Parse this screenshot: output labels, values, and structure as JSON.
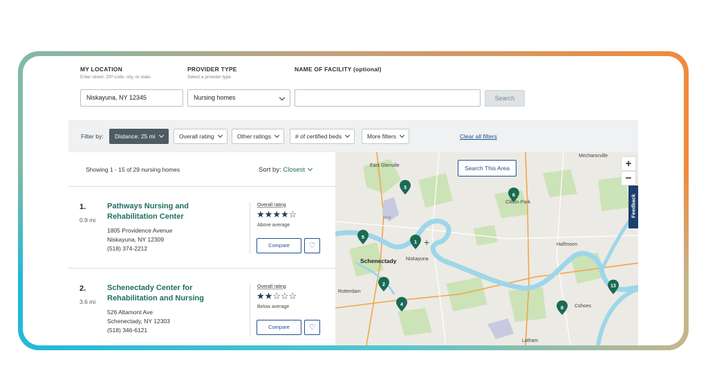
{
  "search": {
    "location_label": "MY LOCATION",
    "location_hint": "Enter street, ZIP code, city, or state.",
    "location_value": "Niskayuna, NY 12345",
    "provider_label": "PROVIDER TYPE",
    "provider_hint": "Select a provider type.",
    "provider_value": "Nursing homes",
    "facility_label": "NAME OF FACILITY (optional)",
    "facility_value": "",
    "search_button": "Search"
  },
  "filters": {
    "filter_by": "Filter by:",
    "distance": "Distance: 25 mi",
    "overall_rating": "Overall rating",
    "other_ratings": "Other ratings",
    "certified_beds": "# of certified beds",
    "more_filters": "More filters",
    "clear_all": "Clear all filters"
  },
  "results": {
    "showing": "Showing 1 - 15 of 29 nursing homes",
    "sort_label": "Sort by:",
    "sort_value": "Closest",
    "items": [
      {
        "number": "1.",
        "distance": "0.9 mi",
        "name": "Pathways Nursing and Rehabilitation Center",
        "street": "1805 Providence Avenue",
        "city": "Niskayuna, NY 12309",
        "phone": "(518) 374-2212",
        "rating_label": "Overall rating",
        "stars": 4,
        "rating_text": "Above average",
        "compare": "Compare"
      },
      {
        "number": "2.",
        "distance": "3.6 mi",
        "name": "Schenectady Center for Rehabilitation and Nursing",
        "street": "526 Altamont Ave",
        "city": "Schenectady, NY 12303",
        "phone": "(518) 346-6121",
        "rating_label": "Overall rating",
        "stars": 2,
        "rating_text": "Below average",
        "compare": "Compare"
      }
    ]
  },
  "map": {
    "search_area": "Search This Area",
    "zoom_in": "+",
    "zoom_out": "−",
    "feedback": "Feedback",
    "places": {
      "east_glenville": "East Glenville",
      "mechanicville": "Mechanicville",
      "clifton_park": "Clifton Park",
      "halfmoon": "Halfmoon",
      "schenectady": "Schenectady",
      "niskayuna": "Niskayuna",
      "rotterdam": "Rotterdam",
      "cohoes": "Cohoes",
      "latham": "Latham",
      "sch": "SCH"
    },
    "pins": [
      "1",
      "2",
      "3",
      "4",
      "5",
      "6",
      "8",
      "13"
    ],
    "colors": {
      "water": "#9dd6ea",
      "green": "#c9e3b3",
      "pin": "#1b6a55",
      "road": "#f0a54a"
    }
  }
}
